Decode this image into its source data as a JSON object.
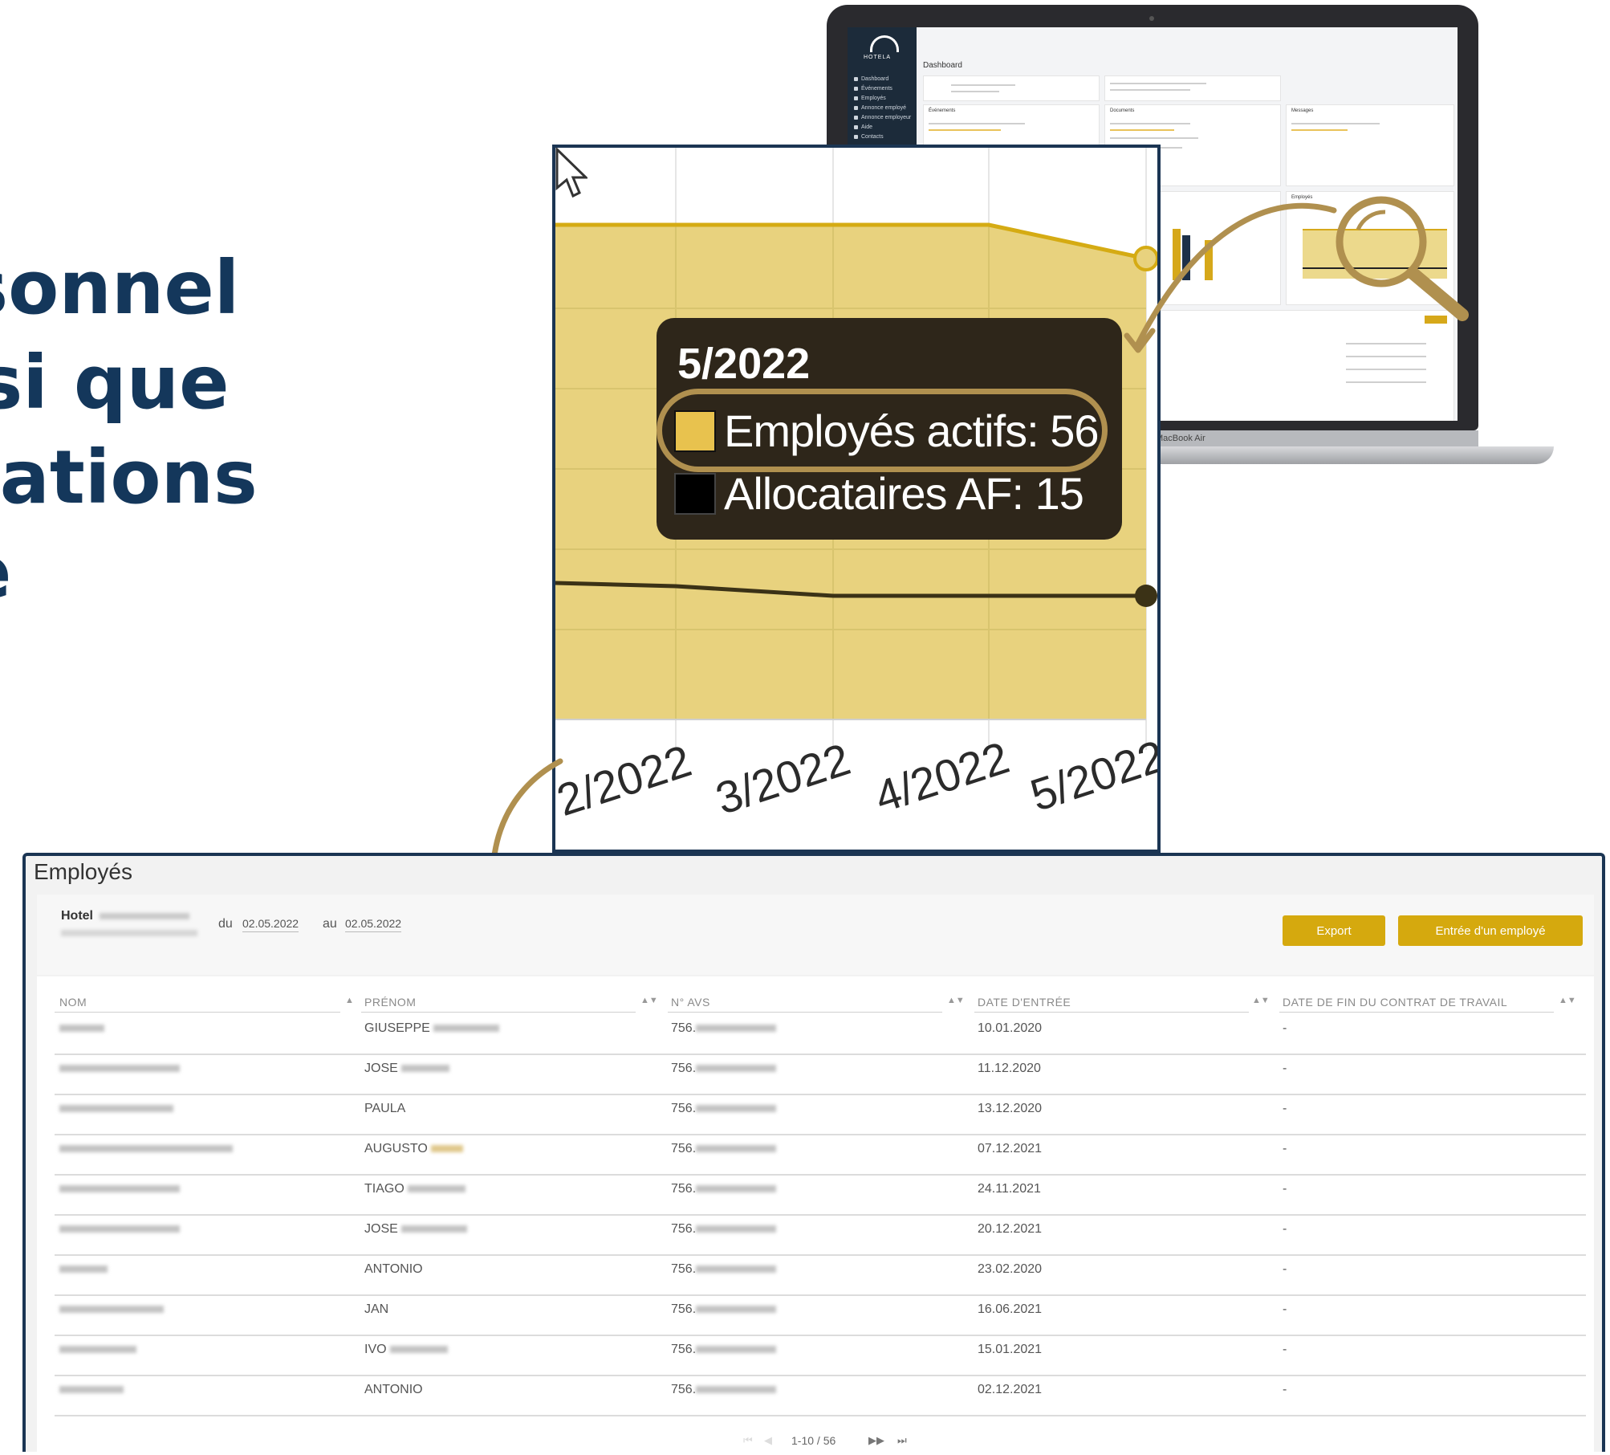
{
  "headline": {
    "lines": [
      "rsonnel",
      "nsi que",
      "ocations",
      "e"
    ]
  },
  "laptop": {
    "title": "Dashboard",
    "brand": "HOTELA",
    "nav_items": [
      "Dashboard",
      "Événements",
      "Employés",
      "Annonce employé",
      "Annonce employeur",
      "Aide",
      "Contacts"
    ],
    "cards": {
      "events": "Événements",
      "documents": "Documents",
      "messages": "Messages",
      "employees": "Employés"
    },
    "macbook_label": "MacBook Air"
  },
  "zoom": {
    "tooltip_title": "5/2022",
    "row1": "Employés actifs: 56",
    "row2": "Allocataires AF: 15",
    "x_ticks": [
      "2/2022",
      "3/2022",
      "4/2022",
      "5/2022"
    ],
    "colors": {
      "area": "#e8d27e",
      "area_line": "#d5ab13",
      "line": "#3b3216",
      "tooltip_bg": "#2e261a",
      "ring": "#b0904f"
    }
  },
  "employees": {
    "title": "Employés",
    "hotel_label": "Hotel",
    "from_label": "du",
    "from_date": "02.05.2022",
    "to_label": "au",
    "to_date": "02.05.2022",
    "export_label": "Export",
    "add_label": "Entrée d'un employé",
    "columns": [
      "NOM",
      "PRÉNOM",
      "N° AVS",
      "DATE D'ENTRÉE",
      "DATE DE FIN DU CONTRAT DE TRAVAIL"
    ],
    "rows": [
      {
        "prenom": "GIUSEPPE",
        "avs": "756.",
        "entree": "10.01.2020",
        "fin": "-"
      },
      {
        "prenom": "JOSE",
        "avs": "756.",
        "entree": "11.12.2020",
        "fin": "-"
      },
      {
        "prenom": "PAULA",
        "avs": "756.",
        "entree": "13.12.2020",
        "fin": "-"
      },
      {
        "prenom": "AUGUSTO",
        "avs": "756.",
        "entree": "07.12.2021",
        "fin": "-"
      },
      {
        "prenom": "TIAGO",
        "avs": "756.",
        "entree": "24.11.2021",
        "fin": "-"
      },
      {
        "prenom": "JOSE",
        "avs": "756.",
        "entree": "20.12.2021",
        "fin": "-"
      },
      {
        "prenom": "ANTONIO",
        "avs": "756.",
        "entree": "23.02.2020",
        "fin": "-"
      },
      {
        "prenom": "JAN",
        "avs": "756.",
        "entree": "16.06.2021",
        "fin": "-"
      },
      {
        "prenom": "IVO",
        "avs": "756.",
        "entree": "15.01.2021",
        "fin": "-"
      },
      {
        "prenom": "ANTONIO",
        "avs": "756.",
        "entree": "02.12.2021",
        "fin": "-"
      }
    ],
    "pagination": "1-10 / 56"
  }
}
